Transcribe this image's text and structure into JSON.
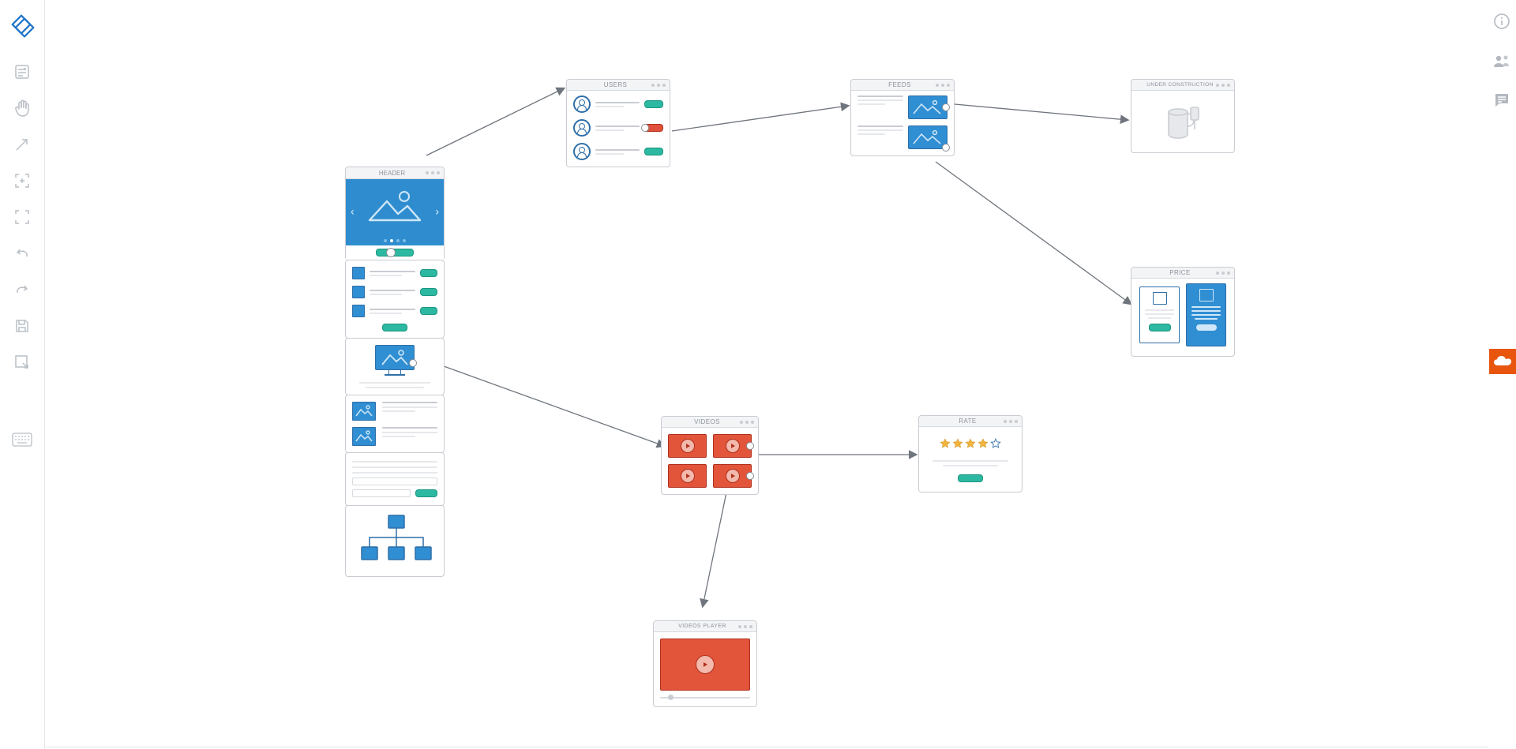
{
  "toolbar": {
    "tools": [
      "cards",
      "hand",
      "arrow",
      "expand",
      "fullscreen",
      "undo",
      "redo",
      "save",
      "export"
    ],
    "bottom_tool": "keyboard"
  },
  "right_rail": {
    "icons": [
      "info",
      "share",
      "chat"
    ],
    "cloud": "cloud"
  },
  "panels": {
    "header": {
      "title": "HEADER"
    },
    "users": {
      "title": "USERS"
    },
    "feeds": {
      "title": "FEEDS"
    },
    "under": {
      "title": "UNDER CONSTRUCTION"
    },
    "price": {
      "title": "PRICE"
    },
    "videos": {
      "title": "VIDEOS"
    },
    "rate": {
      "title": "RATE"
    },
    "vplayer": {
      "title": "VIDEOS PLAYER"
    }
  },
  "rate": {
    "stars_filled": 4,
    "stars_total": 5
  }
}
